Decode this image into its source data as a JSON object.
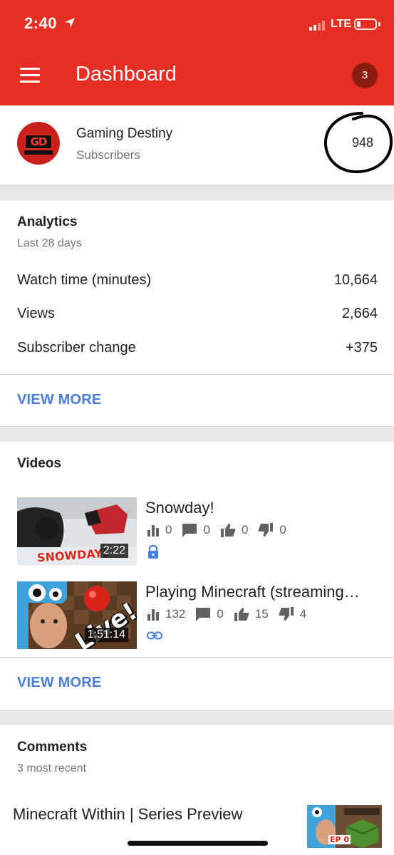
{
  "status_bar": {
    "time": "2:40",
    "network": "LTE",
    "icons": [
      "location-arrow-icon",
      "signal-icon",
      "battery-icon"
    ]
  },
  "app_bar": {
    "title": "Dashboard",
    "notification_count": "3",
    "icons": [
      "menu-icon"
    ],
    "color": "#e62f22"
  },
  "channel": {
    "name": "Gaming Destiny",
    "avatar_text": "GD",
    "subscribers_label": "Subscribers",
    "subscriber_count": "948"
  },
  "analytics": {
    "title": "Analytics",
    "period": "Last 28 days",
    "stats": [
      {
        "label": "Watch time (minutes)",
        "value": "10,664"
      },
      {
        "label": "Views",
        "value": "2,664"
      },
      {
        "label": "Subscriber change",
        "value": "+375"
      }
    ],
    "view_more": "VIEW MORE"
  },
  "videos": {
    "title": "Videos",
    "items": [
      {
        "title": "Snowday!",
        "duration": "2:22",
        "thumb_text": "SNOWDAY!",
        "views": "0",
        "comments": "0",
        "likes": "0",
        "dislikes": "0",
        "visibility_icon": "lock-icon"
      },
      {
        "title": "Playing Minecraft (streaming…",
        "duration": "1:51:14",
        "thumb_text": "Live!",
        "views": "132",
        "comments": "0",
        "likes": "15",
        "dislikes": "4",
        "visibility_icon": "link-icon"
      }
    ],
    "view_more": "VIEW MORE"
  },
  "comments": {
    "title": "Comments",
    "subtitle": "3 most recent",
    "video_title": "Minecraft Within | Series Preview",
    "thumb_text": "EP 0"
  },
  "accent_link_color": "#4a7dd6"
}
